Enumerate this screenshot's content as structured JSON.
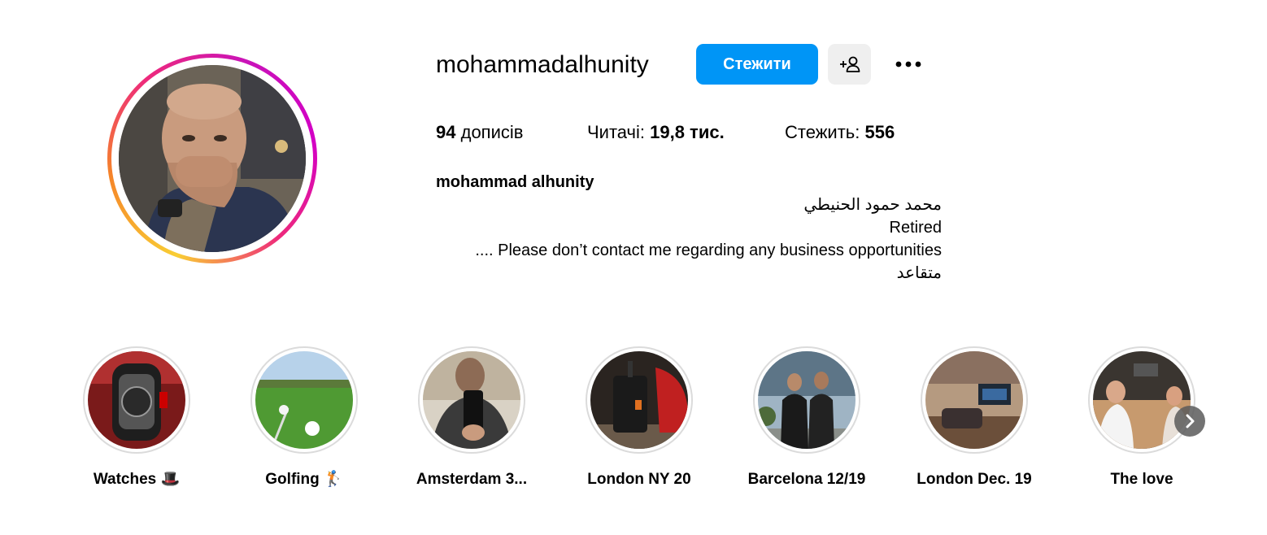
{
  "profile": {
    "username": "mohammadalhunity",
    "follow_label": "Стежити",
    "full_name": "mohammad alhunity",
    "bio_lines": [
      "محمد حمود الحنيطي",
      "Retired",
      ".... Please don’t contact me regarding any business opportunities",
      "متقاعد"
    ]
  },
  "stats": {
    "posts_value": "94",
    "posts_label": "дописів",
    "followers_label": "Читачі:",
    "followers_value": "19,8 тис.",
    "following_label": "Стежить:",
    "following_value": "556"
  },
  "highlights": [
    {
      "label": "Watches 🎩"
    },
    {
      "label": "Golfing 🏌"
    },
    {
      "label": "Amsterdam 3..."
    },
    {
      "label": "London NY 20"
    },
    {
      "label": "Barcelona 12/19"
    },
    {
      "label": "London Dec. 19"
    },
    {
      "label": "The love"
    }
  ],
  "icons": {
    "suggest": "add-person-icon",
    "more": "more-options-icon",
    "next": "chevron-right-icon"
  },
  "colors": {
    "primary_button": "#0095f6",
    "secondary_button": "#efefef",
    "ring_border": "#dbdbdb"
  }
}
